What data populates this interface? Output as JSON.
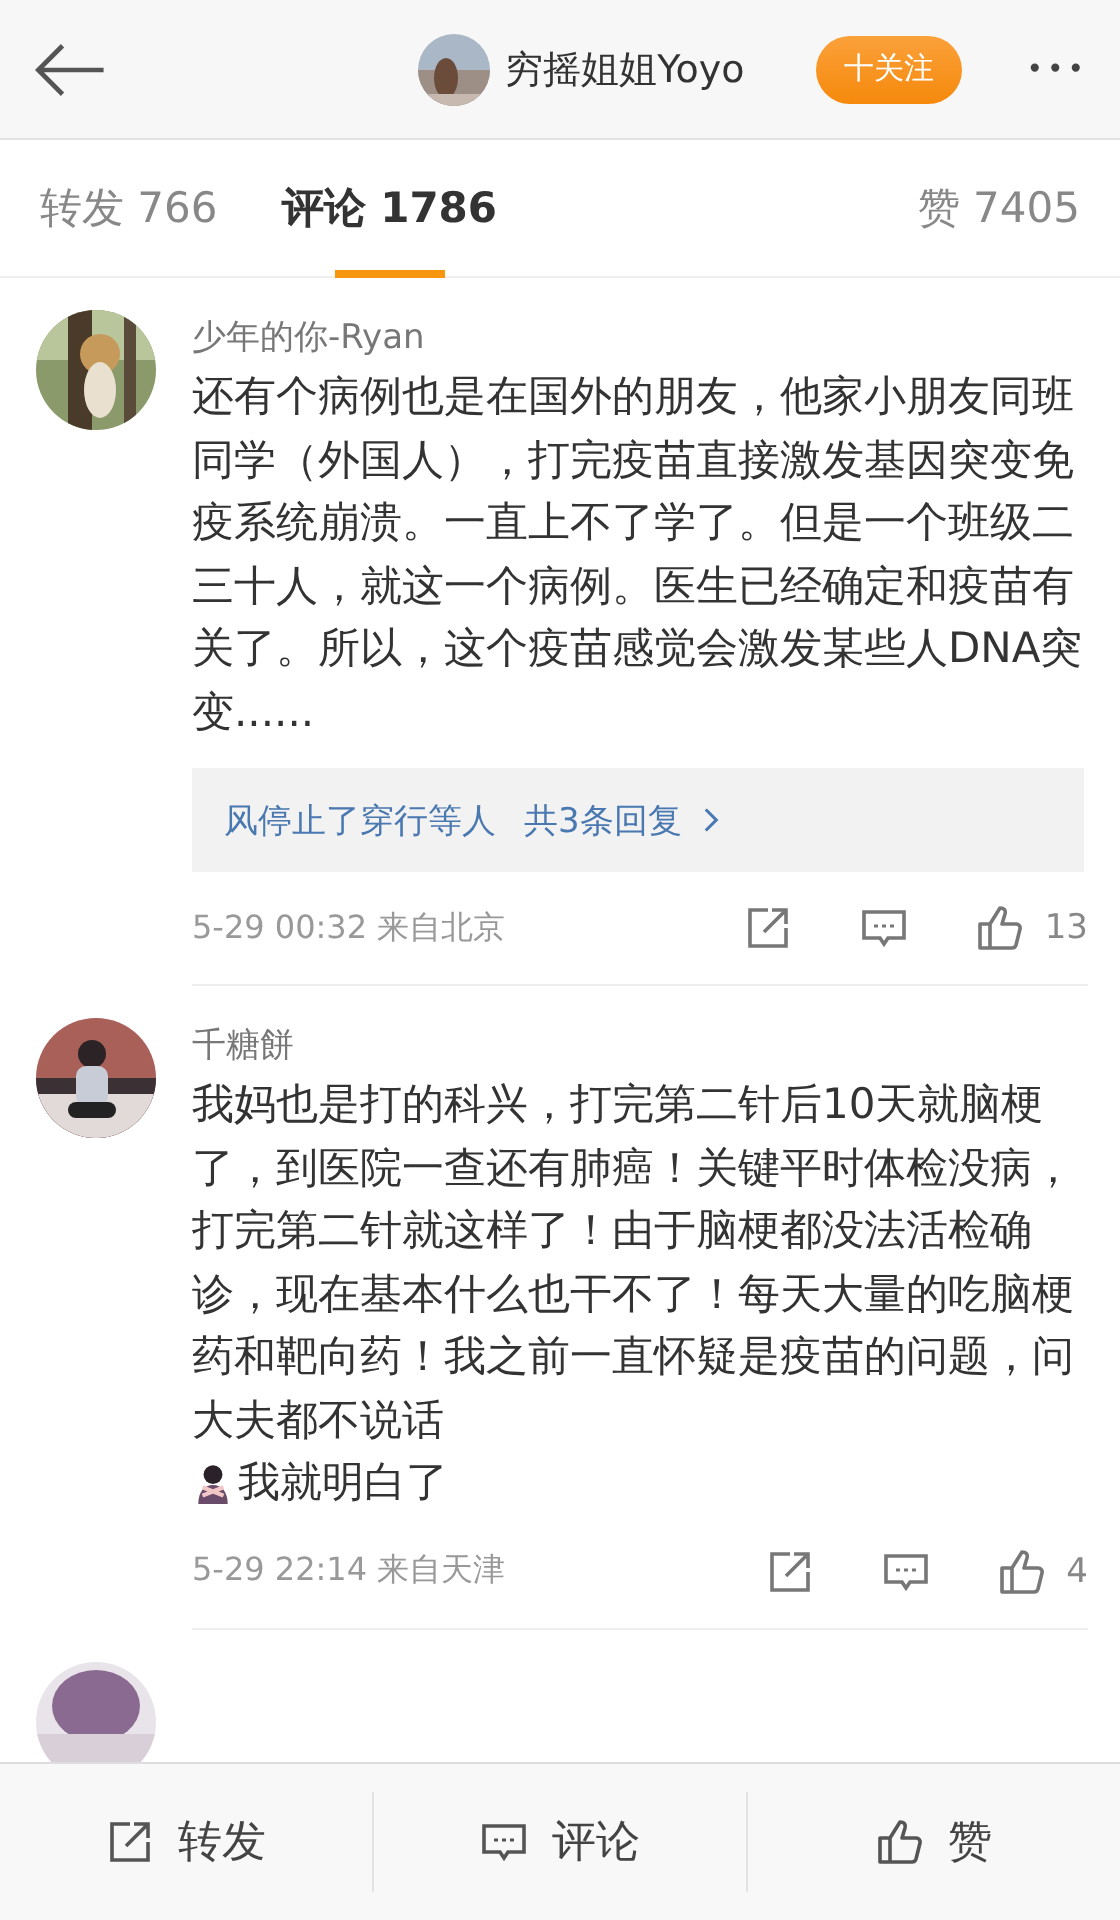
{
  "header": {
    "author": "穷摇姐姐Yoyo",
    "follow_button": "十关注",
    "more": "•••"
  },
  "tabs": [
    {
      "label": "转发",
      "count": "766",
      "selected": false
    },
    {
      "label": "评论",
      "count": "1786",
      "selected": true
    },
    {
      "label": "赞",
      "count": "7405",
      "selected": false
    }
  ],
  "comments": [
    {
      "kind": "comment",
      "user": "少年的你-Ryan",
      "text": [
        "还有个病例也是在国外的朋友，他家小朋友同班同学（外国人），打完疫苗直接激发基因突变免疫系统崩溃。一直上不了学了。但是一个班级二三十人，就这一个病例。医生已经确定和疫苗有关了。所以，这个疫苗感觉会激发某些人DNA突变......"
      ],
      "replies": {
        "users": "风停止了穿行等人",
        "count": "共3条回复"
      },
      "time": "5-29 00:32",
      "location": "来自北京",
      "likes": "13"
    },
    {
      "kind": "comment",
      "user": "千糖餅",
      "text": [
        "我妈也是打的科兴，打完第二针后10天就脑梗了，到医院一查还有肺癌！关键平时体检没病，打完第二针就这样了！由于脑梗都没法活检确诊，现在基本什么也干不了！每天大量的吃脑梗药和靶向药！我之前一直怀疑是疫苗的问题，问大夫都不说话",
        "我就明白了"
      ],
      "time": "5-29 22:14",
      "location": "来自天津",
      "likes": "4"
    },
    {
      "kind": "cut_off"
    }
  ],
  "bottom_bar": [
    {
      "kind": "repost",
      "label": "转发"
    },
    {
      "kind": "comment",
      "label": "评论"
    },
    {
      "kind": "like",
      "label": "赞"
    }
  ]
}
